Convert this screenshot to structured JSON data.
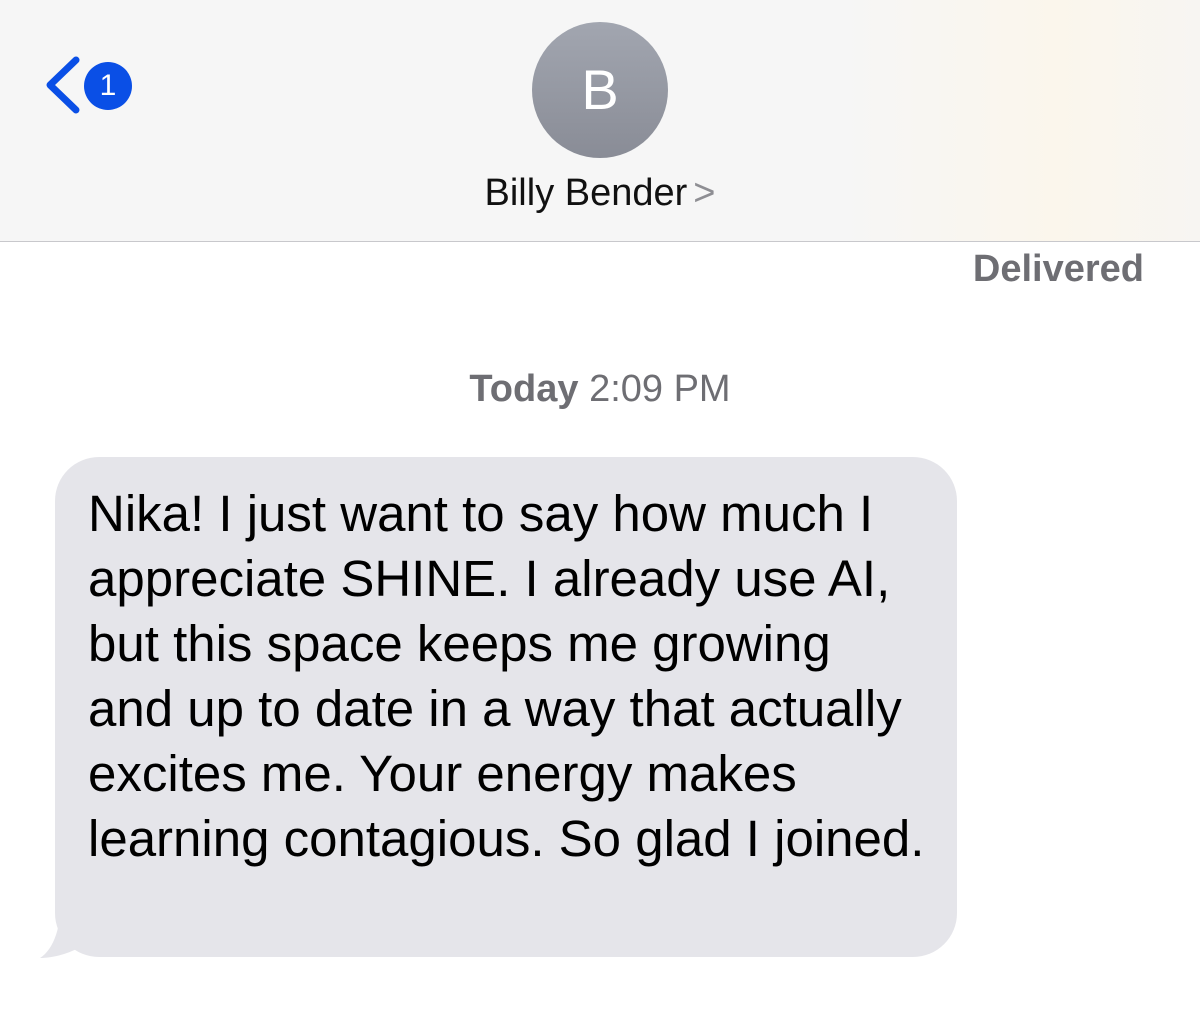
{
  "header": {
    "back_badge_count": "1",
    "avatar_initial": "B",
    "contact_name": "Billy Bender",
    "contact_chevron": ">"
  },
  "status": {
    "delivered": "Delivered"
  },
  "thread": {
    "timestamp_day": "Today",
    "timestamp_time": "2:09 PM"
  },
  "message": {
    "sender": "incoming",
    "text": "Nika! I just want to say how much I appreciate SHINE. I already use AI, but this space keeps me growing and up to date in a way that actually excites me. Your energy makes learning contagious. So glad I joined."
  },
  "colors": {
    "accent": "#0a4fe6",
    "incoming_bubble": "#e5e5ea",
    "secondary_text": "#6e6e73"
  },
  "icons": [
    "chevron-left-icon",
    "chevron-right-icon"
  ]
}
